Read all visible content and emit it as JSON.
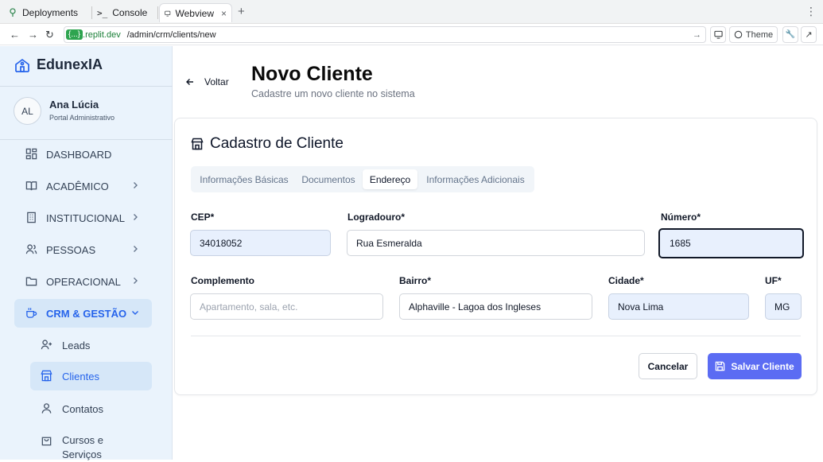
{
  "browser": {
    "tabs": [
      {
        "label": "Deployments"
      },
      {
        "label": "Console"
      },
      {
        "label": "Webview"
      }
    ],
    "url_host": "{...}",
    "url_domain": ".replit.dev",
    "url_path": "/admin/crm/clients/new",
    "theme_label": "Theme"
  },
  "sidebar": {
    "brand": "EdunexIA",
    "user": {
      "initials": "AL",
      "name": "Ana Lúcia",
      "role": "Portal Administrativo"
    },
    "items": [
      {
        "label": "DASHBOARD"
      },
      {
        "label": "ACADÊMICO"
      },
      {
        "label": "INSTITUCIONAL"
      },
      {
        "label": "PESSOAS"
      },
      {
        "label": "OPERACIONAL"
      },
      {
        "label": "CRM & GESTÃO"
      }
    ],
    "subitems": [
      {
        "label": "Leads"
      },
      {
        "label": "Clientes"
      },
      {
        "label": "Contatos"
      },
      {
        "label": "Cursos e Serviços"
      }
    ]
  },
  "page": {
    "back_label": "Voltar",
    "title": "Novo Cliente",
    "subtitle": "Cadastre um novo cliente no sistema"
  },
  "card": {
    "title": "Cadastro de Cliente",
    "tabs": [
      "Informações Básicas",
      "Documentos",
      "Endereço",
      "Informações Adicionais"
    ],
    "active_tab": "Endereço"
  },
  "form": {
    "cep": {
      "label": "CEP*",
      "value": "34018052"
    },
    "logradouro": {
      "label": "Logradouro*",
      "value": "Rua Esmeralda"
    },
    "numero": {
      "label": "Número*",
      "value": "1685"
    },
    "complemento": {
      "label": "Complemento",
      "placeholder": "Apartamento, sala, etc."
    },
    "bairro": {
      "label": "Bairro*",
      "value": "Alphaville - Lagoa dos Ingleses"
    },
    "cidade": {
      "label": "Cidade*",
      "value": "Nova Lima"
    },
    "uf": {
      "label": "UF*",
      "value": "MG"
    }
  },
  "actions": {
    "cancel": "Cancelar",
    "save": "Salvar Cliente"
  },
  "colors": {
    "accent": "#5b6cf3",
    "sidebar_bg": "#eaf3fc",
    "active_blue": "#2563eb",
    "filled_bg": "#e8f0fd"
  }
}
